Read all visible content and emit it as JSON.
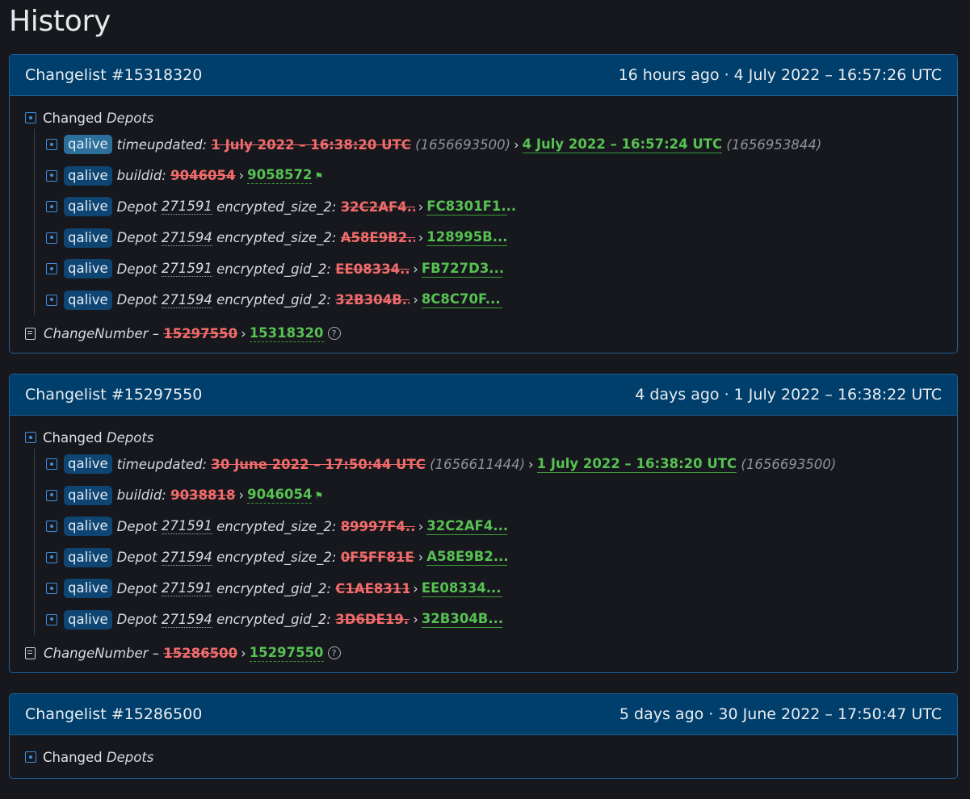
{
  "page": {
    "title": "History"
  },
  "changelists": [
    {
      "title": "Changelist #15318320",
      "time": "16 hours ago · 4 July 2022 – 16:57:26 UTC",
      "group": {
        "label": "Changed",
        "type": "Depots"
      },
      "rows": [
        {
          "branch": "qalive",
          "key": "timeupdated:",
          "old": "1 July 2022 – 16:38:20 UTC",
          "old_raw": "(1656693500)",
          "new": "4 July 2022 – 16:57:24 UTC",
          "new_raw": "(1656953844)"
        },
        {
          "branch": "qalive",
          "key": "buildid:",
          "old": "9046054",
          "new": "9058572"
        },
        {
          "branch": "qalive",
          "depot_prefix": "Depot",
          "depot": "271591",
          "key": "encrypted_size_2:",
          "old": "32C2AF4...",
          "new": "FC8301F1..."
        },
        {
          "branch": "qalive",
          "depot_prefix": "Depot",
          "depot": "271594",
          "key": "encrypted_size_2:",
          "old": "A58E9B2...",
          "new": "128995B..."
        },
        {
          "branch": "qalive",
          "depot_prefix": "Depot",
          "depot": "271591",
          "key": "encrypted_gid_2:",
          "old": "EE08334...",
          "new": "FB727D3..."
        },
        {
          "branch": "qalive",
          "depot_prefix": "Depot",
          "depot": "271594",
          "key": "encrypted_gid_2:",
          "old": "32B304B...",
          "new": "8C8C70F..."
        }
      ],
      "changenumber": {
        "label": "ChangeNumber",
        "dash": "–",
        "old": "15297550",
        "new": "15318320",
        "help": "?"
      }
    },
    {
      "title": "Changelist #15297550",
      "time": "4 days ago · 1 July 2022 – 16:38:22 UTC",
      "group": {
        "label": "Changed",
        "type": "Depots"
      },
      "rows": [
        {
          "branch": "qalive",
          "key": "timeupdated:",
          "old": "30 June 2022 – 17:50:44 UTC",
          "old_raw": "(1656611444)",
          "new": "1 July 2022 – 16:38:20 UTC",
          "new_raw": "(1656693500)"
        },
        {
          "branch": "qalive",
          "key": "buildid:",
          "old": "9038818",
          "new": "9046054"
        },
        {
          "branch": "qalive",
          "depot_prefix": "Depot",
          "depot": "271591",
          "key": "encrypted_size_2:",
          "old": "89997F4...",
          "new": "32C2AF4..."
        },
        {
          "branch": "qalive",
          "depot_prefix": "Depot",
          "depot": "271594",
          "key": "encrypted_size_2:",
          "old": "0F5FF81E...",
          "new": "A58E9B2..."
        },
        {
          "branch": "qalive",
          "depot_prefix": "Depot",
          "depot": "271591",
          "key": "encrypted_gid_2:",
          "old": "C1AE8311...",
          "new": "EE08334..."
        },
        {
          "branch": "qalive",
          "depot_prefix": "Depot",
          "depot": "271594",
          "key": "encrypted_gid_2:",
          "old": "3D6DE19...",
          "new": "32B304B..."
        }
      ],
      "changenumber": {
        "label": "ChangeNumber",
        "dash": "–",
        "old": "15286500",
        "new": "15297550",
        "help": "?"
      }
    },
    {
      "title": "Changelist #15286500",
      "time": "5 days ago · 30 June 2022 – 17:50:47 UTC",
      "group": {
        "label": "Changed",
        "type": "Depots"
      }
    }
  ],
  "arrow": "›",
  "icons": {
    "group": "square-dot-icon",
    "row": "square-dot-icon",
    "changenumber": "note-check-icon",
    "help": "help-circle-icon",
    "flag": "megaphone-icon"
  },
  "colors": {
    "header_bg": "#003e6b",
    "old": "#f26b6b",
    "new": "#57c152",
    "badge": "#0f4572",
    "accent": "#3d8fe0"
  }
}
